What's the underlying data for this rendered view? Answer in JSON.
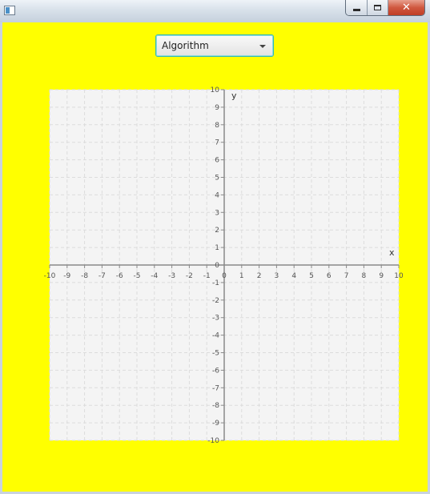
{
  "window": {
    "controls": {
      "minimize_icon": "minimize-icon",
      "maximize_icon": "maximize-icon",
      "close_glyph": "✕"
    }
  },
  "toolbar": {
    "combo_label": "Algorithm"
  },
  "colors": {
    "background": "#ffff00",
    "plot_area": "#f4f4f4",
    "grid": "#dcdcdc",
    "axis": "#8a8a8a",
    "tick_text": "#555555"
  },
  "chart_data": {
    "type": "scatter",
    "xlabel": "x",
    "ylabel": "y",
    "xlim": [
      -10,
      10
    ],
    "ylim": [
      -10,
      10
    ],
    "x_ticks": [
      -10,
      -9,
      -8,
      -7,
      -6,
      -5,
      -4,
      -3,
      -2,
      -1,
      0,
      1,
      2,
      3,
      4,
      5,
      6,
      7,
      8,
      9,
      10
    ],
    "y_ticks": [
      -10,
      -9,
      -8,
      -7,
      -6,
      -5,
      -4,
      -3,
      -2,
      -1,
      0,
      1,
      2,
      3,
      4,
      5,
      6,
      7,
      8,
      9,
      10
    ],
    "grid": true,
    "grid_style": "dashed",
    "series": []
  }
}
